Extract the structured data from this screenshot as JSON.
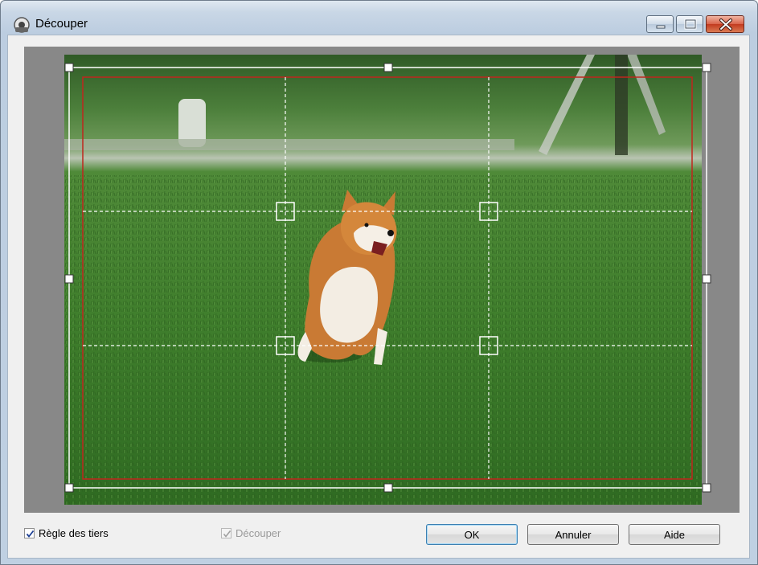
{
  "window": {
    "title": "Découper",
    "controls": [
      "minimize-icon",
      "maximize-icon",
      "close-icon"
    ]
  },
  "crop": {
    "outer_frame_color": "#ffffff",
    "safe_area_color": "#c0261d",
    "grid_line_color": "#ffffff"
  },
  "options": {
    "rule_of_thirds_label": "Règle des tiers",
    "rule_of_thirds_checked": true,
    "crop_label": "Découper",
    "crop_checked": true,
    "crop_enabled": false
  },
  "buttons": {
    "ok_label": "OK",
    "cancel_label": "Annuler",
    "help_label": "Aide"
  }
}
